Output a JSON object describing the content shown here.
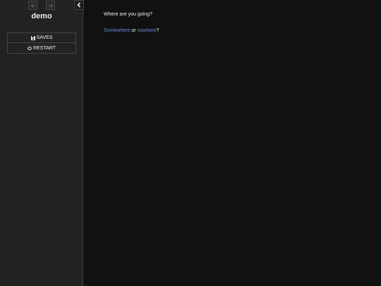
{
  "sidebar": {
    "title": "demo",
    "history": {
      "backward_icon": "arrow-left-icon",
      "forward_icon": "arrow-right-icon"
    },
    "toggle_icon": "chevron-left-icon",
    "menu": {
      "saves_label": "SAVES",
      "saves_icon": "save-icon",
      "restart_label": "RESTART",
      "restart_icon": "power-icon"
    }
  },
  "passage": {
    "question": "Where are you going?",
    "link1": "Somewhere",
    "connector": " or ",
    "link2": "nowhere",
    "end": "?"
  },
  "colors": {
    "background": "#111111",
    "sidebar": "#222222",
    "link": "#6688dd",
    "text": "#eeeeee"
  }
}
